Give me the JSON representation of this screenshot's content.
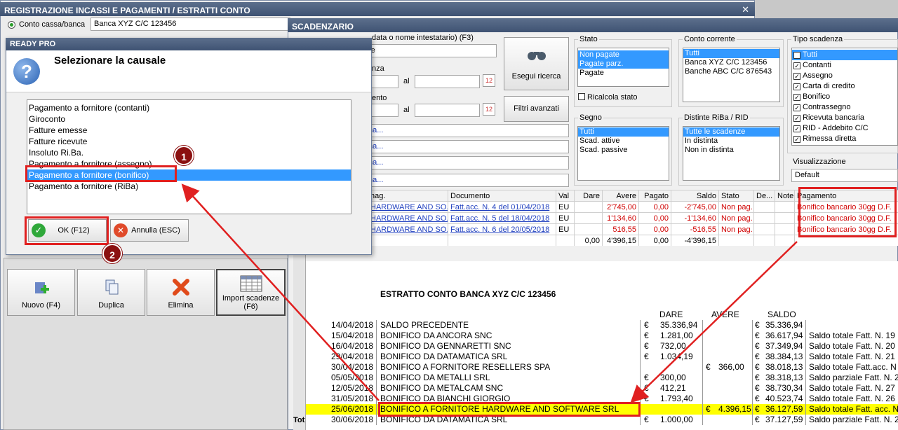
{
  "main_window": {
    "title": "REGISTRAZIONE INCASSI E PAGAMENTI / ESTRATTI CONTO",
    "account_label": "Conto cassa/banca",
    "account_value": "Banca XYZ C/C 123456",
    "toolbar": [
      {
        "label": "Nuovo (F4)",
        "icon": "add-icon"
      },
      {
        "label": "Duplica",
        "icon": "copy-icon"
      },
      {
        "label": "Elimina",
        "icon": "delete-icon"
      },
      {
        "label": "Import scadenze (F6)",
        "icon": "import-table-icon"
      }
    ]
  },
  "scadenzario": {
    "title": "SCADENZARIO",
    "search_label": "data o nome intestatario) (F3)",
    "search_value": "re",
    "scadenza_label": "nza",
    "pagamento_label": "ento",
    "al_label": "al",
    "search_button": "Esegui ricerca",
    "filters_button": "Filtri avanzati",
    "link_rows": [
      "na...",
      "na...",
      "na...",
      "na..."
    ],
    "stato": {
      "label": "Stato",
      "items": [
        "Non pagate",
        "Pagate parz.",
        "Pagate"
      ],
      "recalc_label": "Ricalcola stato"
    },
    "conto_corrente": {
      "label": "Conto corrente",
      "items": [
        "Tutti",
        "Banca XYZ C/C 123456",
        "Banche ABC C/C 876543"
      ]
    },
    "segno": {
      "label": "Segno",
      "items": [
        "Tutti",
        "Scad. attive",
        "Scad. passive"
      ]
    },
    "distinte": {
      "label": "Distinte RiBa / RID",
      "items": [
        "Tutte le scadenze",
        "In distinta",
        "Non in distinta"
      ]
    },
    "tipo_scadenza": {
      "label": "Tipo scadenza",
      "items": [
        "Tutti",
        "Contanti",
        "Assegno",
        "Carta di credito",
        "Bonifico",
        "Contrassegno",
        "Ricevuta bancaria",
        "RID - Addebito C/C",
        "Rimessa diretta"
      ]
    },
    "visualizzazione": {
      "label": "Visualizzazione",
      "value": "Default"
    },
    "table": {
      "headers": [
        "nag.",
        "Documento",
        "Val",
        "Dare",
        "Avere",
        "Pagato",
        "Saldo",
        "Stato",
        "De...",
        "Note",
        "Pagamento"
      ],
      "rows": [
        [
          "HARDWARE AND SO...",
          "Fatt.acc. N. 4 del 01/04/2018",
          "EU",
          "",
          "2'745,00",
          "0,00",
          "-2'745,00",
          "Non pag.",
          "",
          "",
          "Bonifico bancario 30gg D.F."
        ],
        [
          "HARDWARE AND SO...",
          "Fatt.acc. N. 5 del 18/04/2018",
          "EU",
          "",
          "1'134,60",
          "0,00",
          "-1'134,60",
          "Non pag.",
          "",
          "",
          "Bonifico bancario 30gg D.F."
        ],
        [
          "HARDWARE AND SO...",
          "Fatt.acc. N. 6 del 20/05/2018",
          "EU",
          "",
          "516,55",
          "0,00",
          "-516,55",
          "Non pag.",
          "",
          "",
          "Bonifico bancario 30gg D.F."
        ]
      ],
      "totals": [
        "",
        "",
        "",
        "0,00",
        "4'396,15",
        "0,00",
        "-4'396,15",
        "",
        "",
        "",
        ""
      ]
    }
  },
  "dialog": {
    "title": "READY PRO",
    "heading": "Selezionare la causale",
    "items": [
      "Pagamento a fornitore (contanti)",
      "Giroconto",
      "Fatture emesse",
      "Fatture ricevute",
      "Insoluto Ri.Ba.",
      "Pagamento a fornitore (assegno)",
      "Pagamento a fornitore (bonifico)",
      "Pagamento a fornitore (RiBa)"
    ],
    "selected_index": 6,
    "ok_label": "OK (F12)",
    "cancel_label": "Annulla (ESC)"
  },
  "badges": {
    "one": "1",
    "two": "2"
  },
  "statement": {
    "title": "ESTRATTO CONTO BANCA XYZ C/C 123456",
    "col_dare": "DARE",
    "col_avere": "AVERE",
    "col_saldo": "SALDO",
    "euro": "€",
    "rows": [
      {
        "date": "14/04/2018",
        "desc": "SALDO PRECEDENTE",
        "dare": "35.336,94",
        "avere": "",
        "saldo": "35.336,94",
        "note": ""
      },
      {
        "date": "15/04/2018",
        "desc": "BONIFICO DA ANCORA SNC",
        "dare": "1.281,00",
        "avere": "",
        "saldo": "36.617,94",
        "note": "Saldo totale Fatt. N. 19"
      },
      {
        "date": "16/04/2018",
        "desc": "BONIFICO DA GENNARETTI SNC",
        "dare": "732,00",
        "avere": "",
        "saldo": "37.349,94",
        "note": "Saldo totale Fatt. N. 20"
      },
      {
        "date": "29/04/2018",
        "desc": "BONIFICO DA DATAMATICA SRL",
        "dare": "1.034,19",
        "avere": "",
        "saldo": "38.384,13",
        "note": "Saldo totale Fatt. N. 21"
      },
      {
        "date": "30/04/2018",
        "desc": "BONIFICO A FORNITORE RESELLERS SPA",
        "dare": "",
        "avere": "366,00",
        "saldo": "38.018,13",
        "note": "Saldo totale Fatt.acc. N"
      },
      {
        "date": "05/05/2018",
        "desc": "BONIFICO DA METALLI SRL",
        "dare": "300,00",
        "avere": "",
        "saldo": "38.318,13",
        "note": "Saldo parziale Fatt. N. 2"
      },
      {
        "date": "12/05/2018",
        "desc": "BONIFICO DA METALCAM SNC",
        "dare": "412,21",
        "avere": "",
        "saldo": "38.730,34",
        "note": "Saldo totale Fatt. N. 27"
      },
      {
        "date": "31/05/2018",
        "desc": "BONIFICO DA BIANCHI GIORGIO",
        "dare": "1.793,40",
        "avere": "",
        "saldo": "40.523,74",
        "note": "Saldo totale Fatt. N. 26"
      },
      {
        "date": "25/06/2018",
        "desc": "BONIFICO A FORNITORE HARDWARE AND SOFTWARE SRL",
        "dare": "",
        "avere": "4.396,15",
        "saldo": "36.127,59",
        "note": "Saldo totale Fatt. acc. N"
      },
      {
        "date": "30/06/2018",
        "desc": "BONIFICO DA DATAMATICA SRL",
        "dare": "1.000,00",
        "avere": "",
        "saldo": "37.127,59",
        "note": "Saldo parziale Fatt. N. 2"
      }
    ],
    "highlight_index": 8,
    "footer_label": "Tot"
  },
  "colors": {
    "highlight_red": "#e02020",
    "selection_blue": "#3399ff",
    "title_bar": "#4a5d7c",
    "row_yellow": "#ffff00"
  }
}
